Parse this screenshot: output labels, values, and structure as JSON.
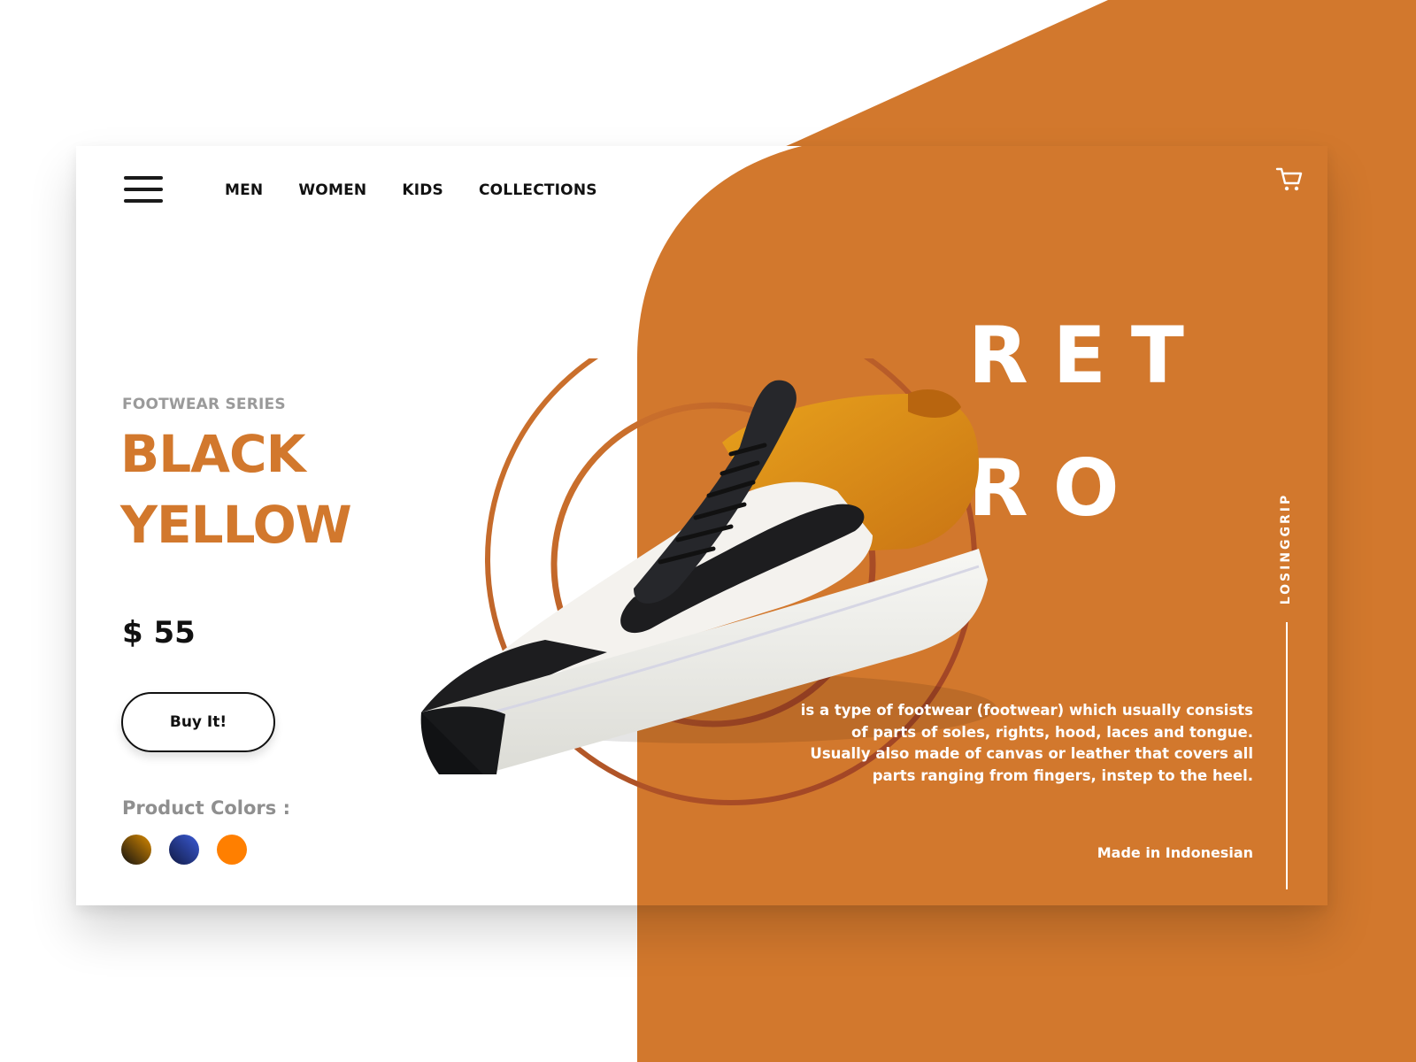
{
  "nav": {
    "items": [
      {
        "label": "MEN"
      },
      {
        "label": "WOMEN"
      },
      {
        "label": "KIDS"
      },
      {
        "label": "COLLECTIONS"
      }
    ]
  },
  "product": {
    "series": "FOOTWEAR SERIES",
    "title_line1": "BLACK",
    "title_line2": "YELLOW",
    "price": "$ 55",
    "buy_label": "Buy It!",
    "colors_label": "Product Colors :",
    "colors": [
      {
        "name": "black-yellow",
        "from": "#d98a00",
        "to": "#111111"
      },
      {
        "name": "blue",
        "from": "#3b5bd6",
        "to": "#111a44"
      },
      {
        "name": "orange",
        "from": "#ff7f00",
        "to": "#ff7f00"
      }
    ]
  },
  "hero": {
    "word_line1": "RET",
    "word_line2": "RO",
    "description": "is a type of footwear (footwear) which usually consists of parts of soles, rights, hood, laces and tongue. Usually also made of canvas or leather that covers all parts ranging from fingers, instep to the heel.",
    "made_in": "Made in Indonesian",
    "brand": "LOSINGGRIP"
  },
  "theme": {
    "accent": "#d2782d",
    "text_dark": "#111111",
    "muted": "#9a9a9a"
  }
}
